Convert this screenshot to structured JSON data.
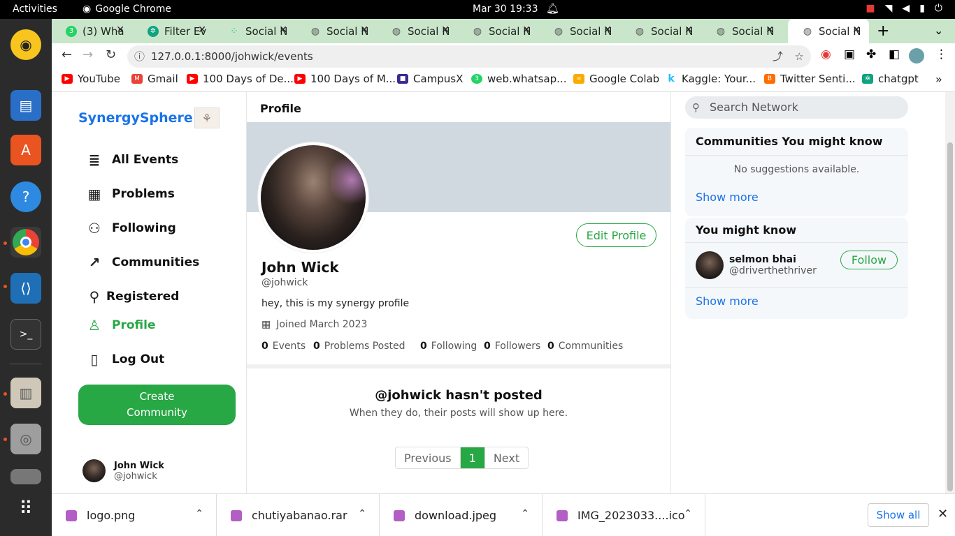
{
  "system": {
    "activities": "Activities",
    "app": "Google Chrome",
    "clock": "Mar 30  19:33"
  },
  "tabs": [
    {
      "label": "(3) Wha",
      "color": "#25d366"
    },
    {
      "label": "Filter Ev",
      "color": "#10a37f"
    },
    {
      "label": "Social N",
      "color": "#2ecc71"
    },
    {
      "label": "Social N",
      "color": "#555555"
    },
    {
      "label": "Social N",
      "color": "#555555"
    },
    {
      "label": "Social N",
      "color": "#555555"
    },
    {
      "label": "Social N",
      "color": "#555555"
    },
    {
      "label": "Social N",
      "color": "#555555"
    },
    {
      "label": "Social N",
      "color": "#555555"
    },
    {
      "label": "Social N",
      "color": "#555555"
    }
  ],
  "address": {
    "url": "127.0.0.1:8000/johwick/events"
  },
  "bookmarks": [
    {
      "label": "YouTube",
      "color": "#ff0000"
    },
    {
      "label": "Gmail",
      "color": "#ea4335"
    },
    {
      "label": "100 Days of De...",
      "color": "#ff0000"
    },
    {
      "label": "100 Days of M...",
      "color": "#ff0000"
    },
    {
      "label": "CampusX",
      "color": "#3b2a8f"
    },
    {
      "label": "web.whatsap...",
      "color": "#25d366"
    },
    {
      "label": "Google Colab",
      "color": "#f9ab00"
    },
    {
      "label": "Kaggle: Your...",
      "color": "#20beff"
    },
    {
      "label": "Twitter Senti...",
      "color": "#ff6d00"
    },
    {
      "label": "chatgpt",
      "color": "#10a37f"
    }
  ],
  "sidebar": {
    "brand": "SynergySphere",
    "items": [
      {
        "label": "All Events",
        "icon": "≣"
      },
      {
        "label": "Problems",
        "icon": "▦"
      },
      {
        "label": "Following",
        "icon": "⚇"
      },
      {
        "label": "Communities",
        "icon": "↗"
      },
      {
        "label": "Registered",
        "icon": "⚲"
      },
      {
        "label": "Profile",
        "icon": "♙"
      },
      {
        "label": "Log Out",
        "icon": "▯"
      }
    ],
    "create_label": "Create Community",
    "user_name": "John Wick",
    "user_handle": "@johwick"
  },
  "profile": {
    "header": "Profile",
    "edit_label": "Edit Profile",
    "name": "John Wick",
    "handle": "@johwick",
    "bio": "hey, this is my synergy profile",
    "joined": "Joined March 2023",
    "stats": {
      "events_n": "0",
      "events_l": "Events",
      "problems_n": "0",
      "problems_l": "Problems Posted",
      "following_n": "0",
      "following_l": "Following",
      "followers_n": "0",
      "followers_l": "Followers",
      "communities_n": "0",
      "communities_l": "Communities"
    },
    "empty_title": "@johwick hasn't posted",
    "empty_sub": "When they do, their posts will show up here.",
    "pager": {
      "prev": "Previous",
      "page": "1",
      "next": "Next"
    }
  },
  "right": {
    "search_placeholder": "Search Network",
    "communities_title": "Communities You might know",
    "no_suggestions": "No suggestions available.",
    "show_more": "Show more",
    "people_title": "You might know",
    "person_name": "selmon bhai",
    "person_handle": "@driverthethriver",
    "follow_label": "Follow"
  },
  "downloads": [
    {
      "name": "logo.png"
    },
    {
      "name": "chutiyabanao.rar"
    },
    {
      "name": "download.jpeg"
    },
    {
      "name": "IMG_2023033....ico"
    }
  ],
  "downloads_show_all": "Show all",
  "colors": {
    "accent": "#28a745",
    "link": "#1a73e8",
    "tabstrip": "#c9e6cb"
  }
}
